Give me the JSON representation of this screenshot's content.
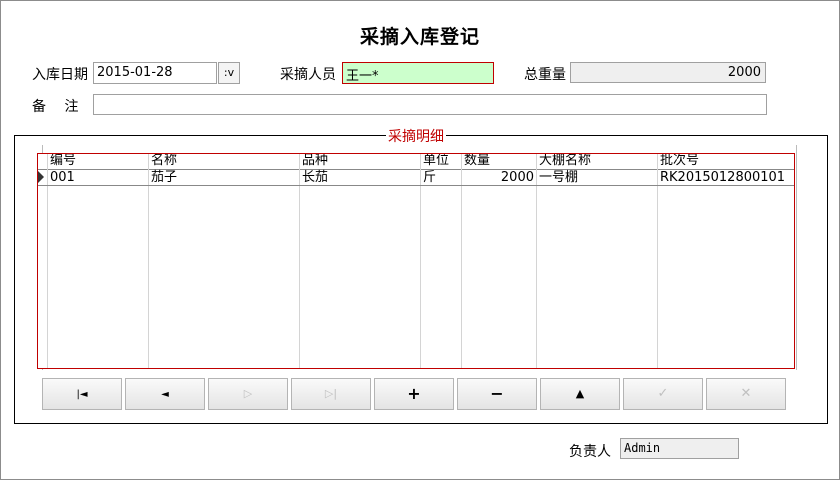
{
  "title": "采摘入库登记",
  "header": {
    "date_label": "入库日期",
    "date_value": "2015-01-28",
    "date_dropdown": ":v",
    "picker_label": "采摘人员",
    "picker_value": "王一*",
    "weight_label": "总重量",
    "weight_value": "2000",
    "remark_label": "备　 注",
    "remark_value": ""
  },
  "details": {
    "caption": "采摘明细",
    "columns": [
      "编号",
      "名称",
      "品种",
      "单位",
      "数量",
      "大棚名称",
      "批次号"
    ],
    "rows": [
      {
        "code": "001",
        "name": "茄子",
        "variety": "长茄",
        "unit": "斤",
        "qty": "2000",
        "greenhouse": "一号棚",
        "batch": "RK2015012800101"
      }
    ]
  },
  "nav": {
    "first": "|◄",
    "prev": "◄",
    "next": "▷",
    "last": "▷|",
    "add": "+",
    "remove": "−",
    "up": "▲",
    "confirm": "✓",
    "cancel": "✕"
  },
  "footer": {
    "owner_label": "负责人",
    "owner_value": "Admin"
  }
}
